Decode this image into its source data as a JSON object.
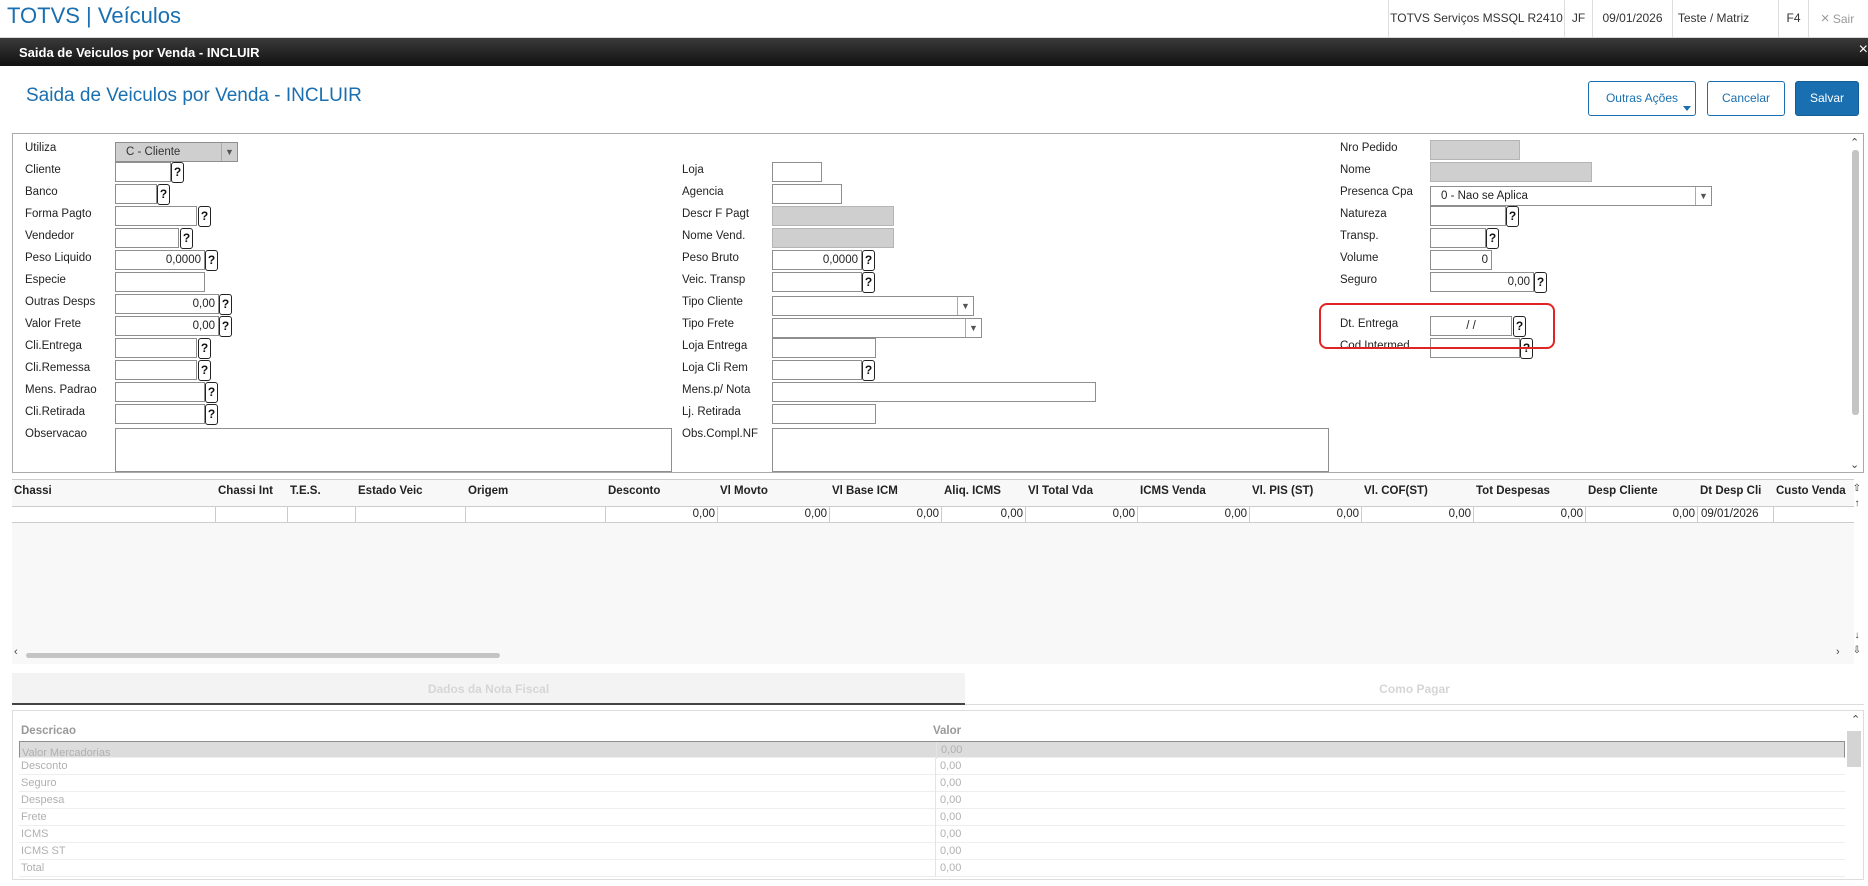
{
  "app": {
    "title": "TOTVS | Veículos"
  },
  "topbar": {
    "server": "TOTVS Serviços MSSQL R2410",
    "branch": "JF",
    "date": "09/01/2026",
    "environment": "Teste / Matriz",
    "help_key": "F4",
    "close_icon": "×",
    "logout_label": "Sair"
  },
  "dialog": {
    "title": "Saida de Veiculos por Venda - INCLUIR",
    "close": "×"
  },
  "header": {
    "title": "Saida de Veiculos por Venda - INCLUIR",
    "other_actions": "Outras Ações",
    "cancel": "Cancelar",
    "save": "Salvar"
  },
  "form": {
    "help_glyph": "?",
    "col1": {
      "utiliza": {
        "label": "Utiliza",
        "value": "C - Cliente"
      },
      "cliente": "Cliente",
      "banco": "Banco",
      "forma_pagto": "Forma Pagto",
      "vendedor": "Vendedor",
      "peso_liquido": {
        "label": "Peso Liquido",
        "value": "0,0000"
      },
      "especie": "Especie",
      "outras_desps": {
        "label": "Outras Desps",
        "value": "0,00"
      },
      "valor_frete": {
        "label": "Valor Frete",
        "value": "0,00"
      },
      "cli_entrega": "Cli.Entrega",
      "cli_remessa": "Cli.Remessa",
      "mens_padrao": "Mens. Padrao",
      "cli_retirada": "Cli.Retirada",
      "observacao": "Observacao"
    },
    "col2": {
      "loja": "Loja",
      "agencia": "Agencia",
      "descr_f_pagt": "Descr F Pagt",
      "nome_vend": "Nome Vend.",
      "peso_bruto": {
        "label": "Peso Bruto",
        "value": "0,0000"
      },
      "veic_transp": "Veic. Transp",
      "tipo_cliente": "Tipo Cliente",
      "tipo_frete": "Tipo Frete",
      "loja_entrega": "Loja Entrega",
      "loja_cli_rem": "Loja Cli Rem",
      "mens_nota": "Mens.p/ Nota",
      "lj_retirada": "Lj. Retirada",
      "obs_compl_nf": "Obs.Compl.NF"
    },
    "col3": {
      "nro_pedido": "Nro Pedido",
      "nome": "Nome",
      "presenca_cpa": {
        "label": "Presenca Cpa",
        "value": "0 - Nao se Aplica"
      },
      "natureza": "Natureza",
      "transp": "Transp.",
      "volume": {
        "label": "Volume",
        "value": "0"
      },
      "seguro": {
        "label": "Seguro",
        "value": "0,00"
      },
      "dt_entrega": {
        "label": "Dt. Entrega",
        "value": "/  /"
      },
      "cod_intermed": "Cod.Intermed"
    }
  },
  "grid": {
    "columns": [
      "Chassi",
      "Chassi Int",
      "T.E.S.",
      "Estado Veic",
      "Origem",
      "Desconto",
      "Vl Movto",
      "Vl Base ICM",
      "Aliq. ICMS",
      "Vl Total Vda",
      "ICMS Venda",
      "Vl. PIS (ST)",
      "Vl. COF(ST)",
      "Tot Despesas",
      "Desp Cliente",
      "Dt Desp Cli",
      "Custo Venda"
    ],
    "row": [
      "",
      "",
      "",
      "",
      "",
      "0,00",
      "0,00",
      "0,00",
      "0,00",
      "0,00",
      "0,00",
      "0,00",
      "0,00",
      "0,00",
      "0,00",
      "09/01/2026",
      ""
    ]
  },
  "tabs": {
    "nota_fiscal": "Dados da Nota Fiscal",
    "como_pagar": "Como Pagar"
  },
  "summary": {
    "header_desc": "Descricao",
    "header_value": "Valor",
    "rows": [
      {
        "desc": "Valor Mercadorias",
        "value": "0,00"
      },
      {
        "desc": "Desconto",
        "value": "0,00"
      },
      {
        "desc": "Seguro",
        "value": "0,00"
      },
      {
        "desc": "Despesa",
        "value": "0,00"
      },
      {
        "desc": "Frete",
        "value": "0,00"
      },
      {
        "desc": "ICMS",
        "value": "0,00"
      },
      {
        "desc": "ICMS ST",
        "value": "0,00"
      },
      {
        "desc": "Total",
        "value": "0,00"
      }
    ]
  }
}
